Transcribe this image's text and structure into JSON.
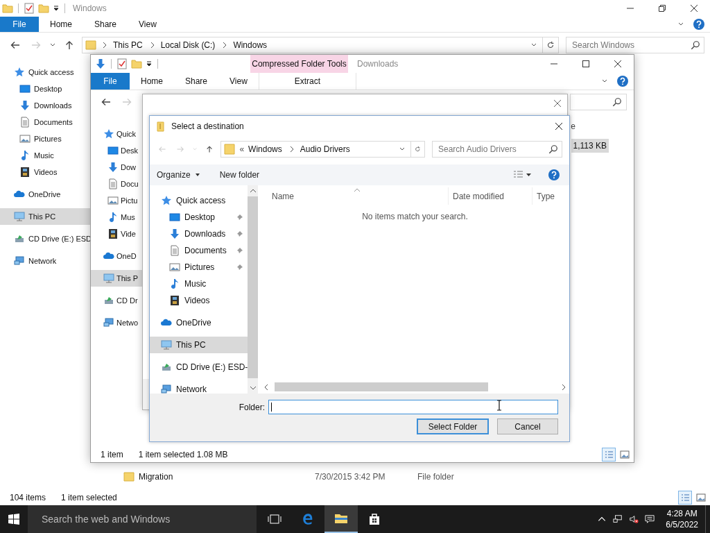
{
  "explorer": {
    "title": "Windows",
    "ribbon_tabs": [
      {
        "label": "File",
        "kind": "file"
      },
      {
        "label": "Home",
        "kind": "tab"
      },
      {
        "label": "Share",
        "kind": "tab"
      },
      {
        "label": "View",
        "kind": "tab"
      }
    ],
    "address": [
      "This PC",
      "Local Disk (C:)",
      "Windows"
    ],
    "search": {
      "placeholder": "Search Windows"
    },
    "nav": [
      {
        "label": "Quick access",
        "kind": "quick-access",
        "selected": false,
        "children": [
          {
            "label": "Desktop",
            "kind": "desktop",
            "selected": false
          },
          {
            "label": "Downloads",
            "kind": "downloads",
            "selected": false
          },
          {
            "label": "Documents",
            "kind": "documents",
            "selected": false
          },
          {
            "label": "Pictures",
            "kind": "pictures",
            "selected": false
          },
          {
            "label": "Music",
            "kind": "music",
            "selected": false
          },
          {
            "label": "Videos",
            "kind": "videos",
            "selected": false
          }
        ]
      },
      {
        "label": "OneDrive",
        "kind": "onedrive",
        "selected": false
      },
      {
        "label": "This PC",
        "kind": "pc",
        "selected": true
      },
      {
        "label": "CD Drive (E:) ESD",
        "kind": "drive",
        "selected": false
      },
      {
        "label": "Network",
        "kind": "network",
        "selected": false
      }
    ],
    "files": [
      {
        "name": "Migration",
        "date": "7/30/2015 3:42 PM",
        "type": "File folder"
      }
    ],
    "status": [
      "104 items",
      "1 item selected"
    ]
  },
  "downloads": {
    "context_tab": "Compressed Folder Tools",
    "title": "Downloads",
    "ribbon_tabs": [
      {
        "label": "File",
        "kind": "file"
      },
      {
        "label": "Home",
        "kind": "tab"
      },
      {
        "label": "Share",
        "kind": "tab"
      },
      {
        "label": "View",
        "kind": "tab"
      }
    ],
    "context_ribbon_tab": "Extract",
    "nav": [
      {
        "label": "Quick",
        "kind": "quick-access",
        "selected": false,
        "children": [
          {
            "label": "Desk",
            "kind": "desktop",
            "selected": false
          },
          {
            "label": "Dow",
            "kind": "downloads",
            "selected": false
          },
          {
            "label": "Docu",
            "kind": "documents",
            "selected": false
          },
          {
            "label": "Pictu",
            "kind": "pictures",
            "selected": false
          },
          {
            "label": "Mus",
            "kind": "music",
            "selected": false
          },
          {
            "label": "Vide",
            "kind": "videos",
            "selected": false
          }
        ]
      },
      {
        "label": "OneD",
        "kind": "onedrive",
        "selected": false
      },
      {
        "label": "This P",
        "kind": "pc",
        "selected": true
      },
      {
        "label": "CD Dr",
        "kind": "drive",
        "selected": false
      },
      {
        "label": "Netwo",
        "kind": "network",
        "selected": false
      }
    ],
    "column_header": "e",
    "selected_size": "1,113 KB",
    "status": [
      "1 item",
      "1 item selected  1.08 MB"
    ]
  },
  "dialog": {
    "title": "Select a destination",
    "overflow": "«",
    "address": [
      "Windows",
      "Audio Drivers"
    ],
    "search": {
      "placeholder": "Search Audio Drivers"
    },
    "toolbar": [
      {
        "label": "Organize",
        "menu": true
      },
      {
        "label": "New folder",
        "menu": false
      }
    ],
    "nav": [
      {
        "label": "Quick access",
        "kind": "quick-access",
        "selected": false,
        "children": [
          {
            "label": "Desktop",
            "kind": "desktop",
            "selected": false,
            "pinned": true
          },
          {
            "label": "Downloads",
            "kind": "downloads",
            "selected": false,
            "pinned": true
          },
          {
            "label": "Documents",
            "kind": "documents",
            "selected": false,
            "pinned": true
          },
          {
            "label": "Pictures",
            "kind": "pictures",
            "selected": false,
            "pinned": true
          },
          {
            "label": "Music",
            "kind": "music",
            "selected": false,
            "pinned": false
          },
          {
            "label": "Videos",
            "kind": "videos",
            "selected": false,
            "pinned": false
          }
        ]
      },
      {
        "label": "OneDrive",
        "kind": "onedrive",
        "selected": false
      },
      {
        "label": "This PC",
        "kind": "pc",
        "selected": true
      },
      {
        "label": "CD Drive (E:) ESD-",
        "kind": "drive",
        "selected": false
      },
      {
        "label": "Network",
        "kind": "network",
        "selected": false
      }
    ],
    "columns": [
      "Name",
      "Date modified",
      "Type"
    ],
    "empty_message": "No items match your search.",
    "folder_field": {
      "label": "Folder:"
    },
    "buttons": [
      {
        "label": "Select Folder",
        "default": true
      },
      {
        "label": "Cancel",
        "default": false
      }
    ]
  },
  "taskbar": {
    "search": {
      "placeholder": "Search the web and Windows"
    },
    "apps": [
      {
        "kind": "task-view",
        "active": false
      },
      {
        "kind": "edge",
        "active": false
      },
      {
        "kind": "explorer",
        "active": true
      },
      {
        "kind": "store",
        "active": false
      }
    ],
    "time": "4:28 AM",
    "date": "6/5/2022"
  }
}
